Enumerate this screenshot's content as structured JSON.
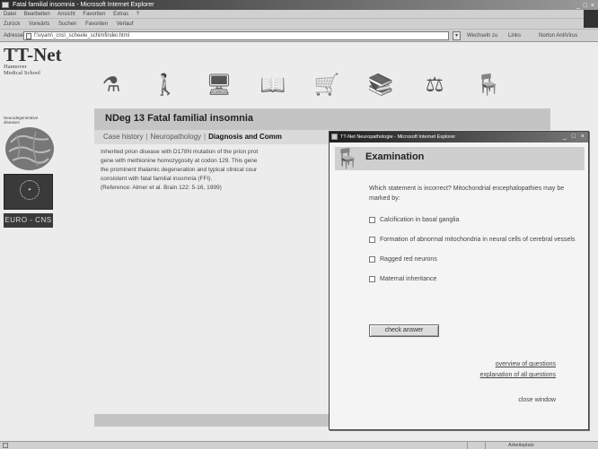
{
  "browser": {
    "title": "Fatal familial insomnia - Microsoft Internet Explorer",
    "window_controls": "_ □ ×",
    "menu": [
      "Datei",
      "Bearbeiten",
      "Ansicht",
      "Favoriten",
      "Extras",
      "?"
    ],
    "toolbar": [
      "Zurück",
      "Vorwärts",
      "Suchen",
      "Favoriten",
      "Verlauf"
    ],
    "address_label": "Adresse",
    "address_value": "f:\\vyam\\_cns\\_scheele_schimfinder.html",
    "go_label": "Wechseln zu",
    "links_label": "Links",
    "extra_label": "Norton AntiVirus"
  },
  "sidebar": {
    "logo_big": "TT-Net",
    "logo_small_lines": [
      "Hannover",
      "Medical School"
    ],
    "caption": "Neurodegenerative diseases",
    "eu_badge": "EURO - CNS"
  },
  "nav_icons": [
    "microscope-icon",
    "person-icon",
    "monitor-icon",
    "book-icon",
    "cart-icon",
    "book-stack-icon",
    "flowchart-icon",
    "examination-icon"
  ],
  "main": {
    "title": "NDeg 13 Fatal familial insomnia",
    "tabs": [
      "Case history",
      "Neuropathology",
      "Diagnosis and Comm"
    ],
    "active_tab": "Diagnosis and Comm",
    "body_lines": [
      "Inherited prion disease with D178N mutation of the prion prot",
      "gene with methionine homozygosity at codon 129. This gene",
      "the prominent thalamic degeneration and typical clinical cour",
      "consistent with fatal familial insomnia (FFI).",
      "(Reference: Almer et al. Brain 122: 5-16, 1999)"
    ]
  },
  "popup": {
    "window_title": "TT-Net Neuropathologie - Microsoft Internet Explorer",
    "window_controls": "_ □ ×",
    "heading": "Examination",
    "question": "Which statement is incorrect? Mitochondrial encephalopathies may be marked by:",
    "options": [
      "Calcification in basal ganglia",
      "Formation of abnormal mitochondria in neural cells of cerebral vessels",
      "Ragged red neurons",
      "Maternal inheritance"
    ],
    "check_button": "check answer",
    "links": [
      "overview of questions",
      "explanation of all questions"
    ],
    "close_label": "close window"
  },
  "statusbar": {
    "zone": "Arbeitsplatz"
  }
}
